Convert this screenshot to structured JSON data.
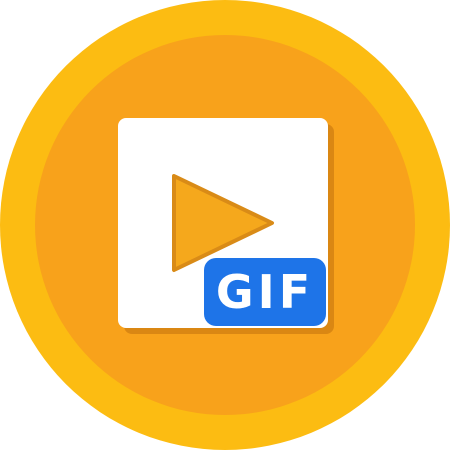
{
  "app_icon": {
    "icon": "video-to-gif-icon",
    "badge_text": "GIF",
    "play_icon": "play-triangle-icon"
  },
  "colors": {
    "outer_circle": "#fcbc12",
    "inner_circle": "#f8a21b",
    "card_background": "#ffffff",
    "card_shadow": "#d07e12",
    "play_triangle": "#f5a81c",
    "play_triangle_border": "#d98b17",
    "badge_background": "#1e74e8",
    "badge_text": "#ffffff"
  }
}
